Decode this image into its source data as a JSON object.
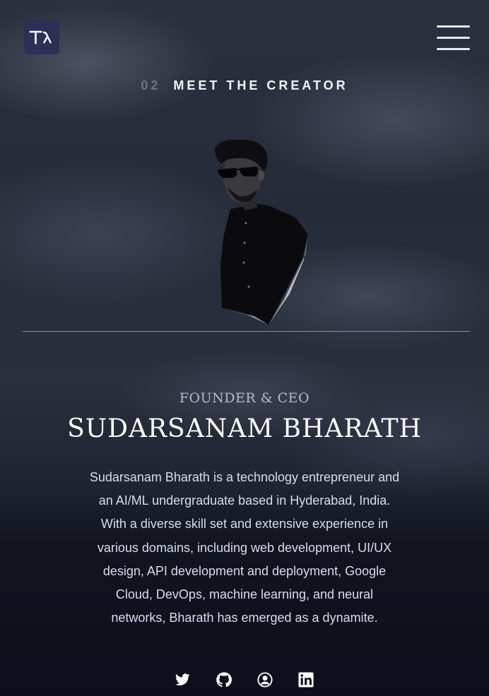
{
  "header": {
    "logo_text": "Tλ",
    "menu_icon": "hamburger-menu-icon"
  },
  "section": {
    "number": "02",
    "title": "MEET THE CREATOR"
  },
  "creator": {
    "role": "FOUNDER & CEO",
    "name": "SUDARSANAM BHARATH",
    "bio": "Sudarsanam Bharath is a technology entrepreneur and an AI/ML undergraduate based in Hyderabad, India. With a diverse skill set and extensive experience in various domains, including web development, UI/UX design, API development and deployment, Google Cloud, DevOps, machine learning, and neural networks, Bharath has emerged as a dynamite."
  },
  "socials": [
    {
      "icon": "twitter-icon"
    },
    {
      "icon": "github-icon"
    },
    {
      "icon": "user-circle-icon"
    },
    {
      "icon": "linkedin-icon"
    }
  ],
  "colors": {
    "background": "#0c0f1b",
    "logo_bg": "#2d2f57",
    "text_primary": "#ffffff",
    "text_muted": "#6f7280"
  }
}
